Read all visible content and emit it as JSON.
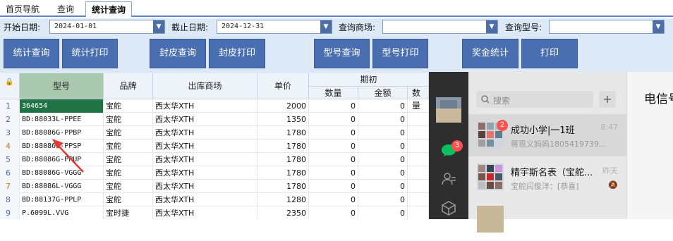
{
  "tabs": [
    {
      "label": "首页导航"
    },
    {
      "label": "查询"
    },
    {
      "label": "统计查询"
    }
  ],
  "filters": {
    "start_label": "开始日期:",
    "start_value": "2024-01-01",
    "end_label": "截止日期:",
    "end_value": "2024-12-31",
    "store_label": "查询商场:",
    "store_value": "",
    "model_label": "查询型号:",
    "model_value": ""
  },
  "buttons": [
    "统计查询",
    "统计打印",
    "封皮查询",
    "封皮打印",
    "型号查询",
    "型号打印",
    "奖金统计",
    "打印"
  ],
  "grid": {
    "headers": {
      "lock": "🔒",
      "model": "型号",
      "brand": "品牌",
      "store": "出库商场",
      "price": "单价",
      "opening": "期初",
      "qty": "数量",
      "amount": "金额",
      "qty2": "数量"
    },
    "rows": [
      {
        "idx": "1",
        "model": "364654",
        "brand": "宝舵",
        "store": "西太华XTH",
        "price": "2000",
        "qty": "0",
        "amount": "0"
      },
      {
        "idx": "2",
        "model": "BD:88033L-PPEE",
        "brand": "宝舵",
        "store": "西太华XTH",
        "price": "1350",
        "qty": "0",
        "amount": "0"
      },
      {
        "idx": "3",
        "model": "BD:88086G-PPBP",
        "brand": "宝舵",
        "store": "西太华XTH",
        "price": "1780",
        "qty": "0",
        "amount": "0"
      },
      {
        "idx": "4",
        "model": "BD:88086G-PPSP",
        "brand": "宝舵",
        "store": "西太华XTH",
        "price": "1780",
        "qty": "0",
        "amount": "0"
      },
      {
        "idx": "5",
        "model": "BD:88086G-PPUP",
        "brand": "宝舵",
        "store": "西太华XTH",
        "price": "1780",
        "qty": "0",
        "amount": "0"
      },
      {
        "idx": "6",
        "model": "BD:88086G-VGGG",
        "brand": "宝舵",
        "store": "西太华XTH",
        "price": "1780",
        "qty": "0",
        "amount": "0"
      },
      {
        "idx": "7",
        "model": "BD:88086L-VGGG",
        "brand": "宝舵",
        "store": "西太华XTH",
        "price": "1780",
        "qty": "0",
        "amount": "0"
      },
      {
        "idx": "8",
        "model": "BD:88137G-PPLP",
        "brand": "宝舵",
        "store": "西太华XTH",
        "price": "1280",
        "qty": "0",
        "amount": "0"
      },
      {
        "idx": "9",
        "model": "P.6099L.VVG",
        "brand": "宝时捷",
        "store": "西太华XTH",
        "price": "2350",
        "qty": "0",
        "amount": "0"
      }
    ]
  },
  "wechat": {
    "search_placeholder": "搜索",
    "plus": "+",
    "chat_badge": "3",
    "main_title": "电信号",
    "conversations": [
      {
        "title": "成功小学|一1班",
        "time": "8:47",
        "preview": "蒋恩义妈妈1805419739...",
        "badge": "2"
      },
      {
        "title": "精宇斯名表（宝舵...",
        "time": "昨天",
        "preview": "宝舵闫俊洋：[恭喜]"
      }
    ]
  },
  "colors": {
    "accent": "#4a6fb1",
    "selected_cell": "#217346",
    "selected_header": "#a9c8ae",
    "annotation_arrow": "#e53935"
  }
}
